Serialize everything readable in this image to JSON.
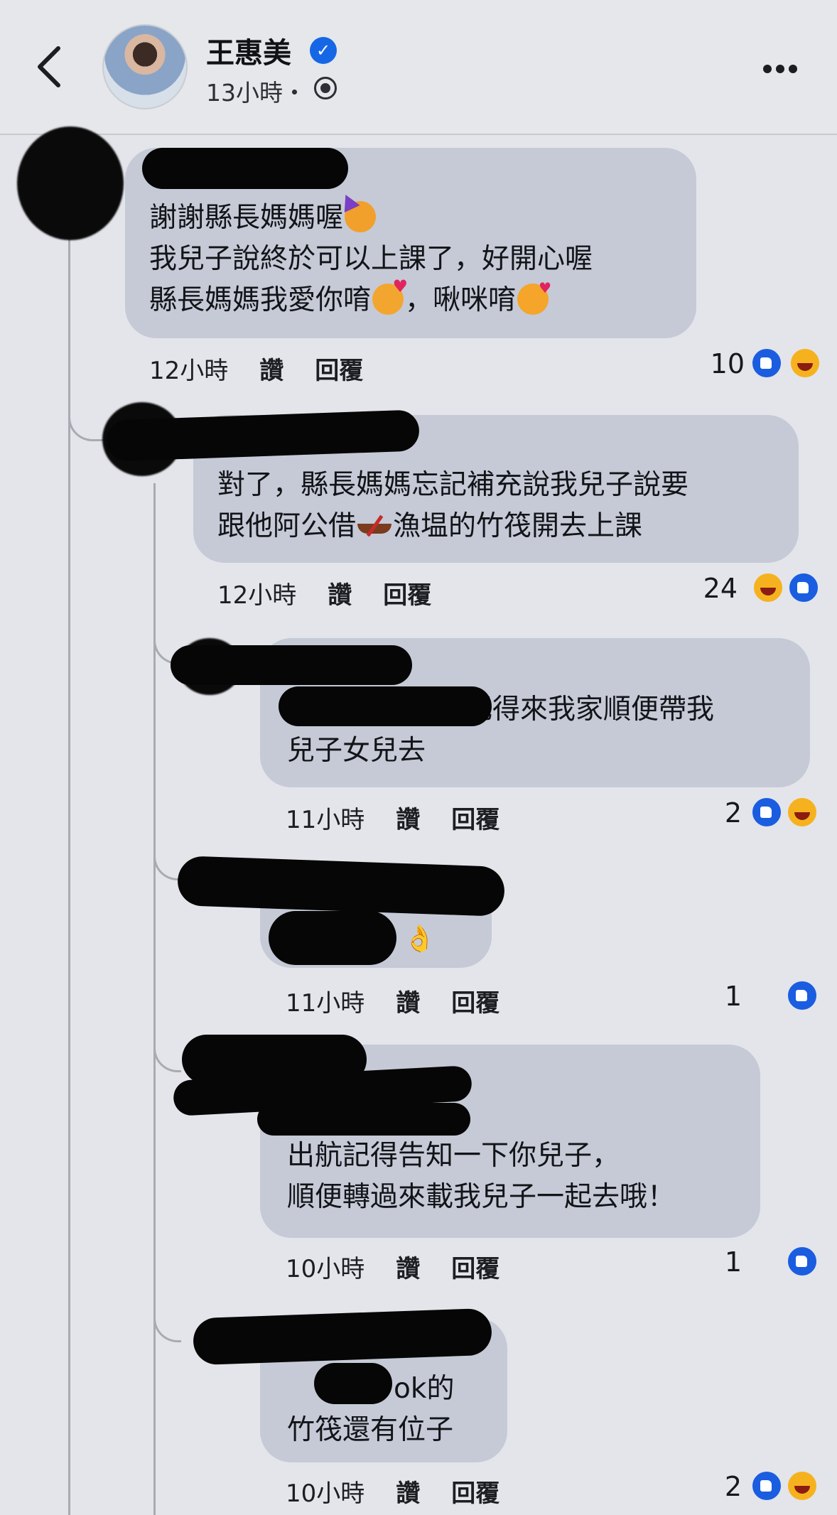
{
  "header": {
    "page_name": "王惠美",
    "meta": "13小時・"
  },
  "actions": {
    "like": "讚",
    "reply": "回覆"
  },
  "comments": [
    {
      "lines": [
        "謝謝縣長媽媽喔",
        "我兒子說終於可以上課了，好開心喔",
        "縣長媽媽我愛你唷",
        "，啾咪唷"
      ],
      "time": "12小時",
      "count": "10",
      "reactions": [
        "like-icon",
        "haha-icon"
      ]
    },
    {
      "lines": [
        "對了，縣長媽媽忘記補充說我兒子說要",
        "跟他阿公借",
        "漁塭的竹筏開去上課"
      ],
      "time": "12小時",
      "count": "24",
      "reactions": [
        "haha-icon",
        "like-icon"
      ]
    },
    {
      "lines": [
        "記得來我家順便帶我",
        "兒子女兒去"
      ],
      "time": "11小時",
      "count": "2",
      "reactions": [
        "like-icon",
        "haha-icon"
      ]
    },
    {
      "lines": [],
      "time": "11小時",
      "count": "1",
      "reactions": [
        "like-icon"
      ]
    },
    {
      "lines": [
        "出航記得告知一下你兒子，",
        "順便轉過來載我兒子一起去哦！"
      ],
      "time": "10小時",
      "count": "1",
      "reactions": [
        "like-icon"
      ]
    },
    {
      "lines": [
        "ok的",
        "竹筏還有位子"
      ],
      "time": "10小時",
      "count": "2",
      "reactions": [
        "like-icon",
        "haha-icon"
      ]
    }
  ],
  "colors": {
    "background": "#e3e5ea",
    "bubble": "#c5cad6",
    "like_blue": "#1a5de0",
    "haha_yellow": "#f6b21e"
  }
}
